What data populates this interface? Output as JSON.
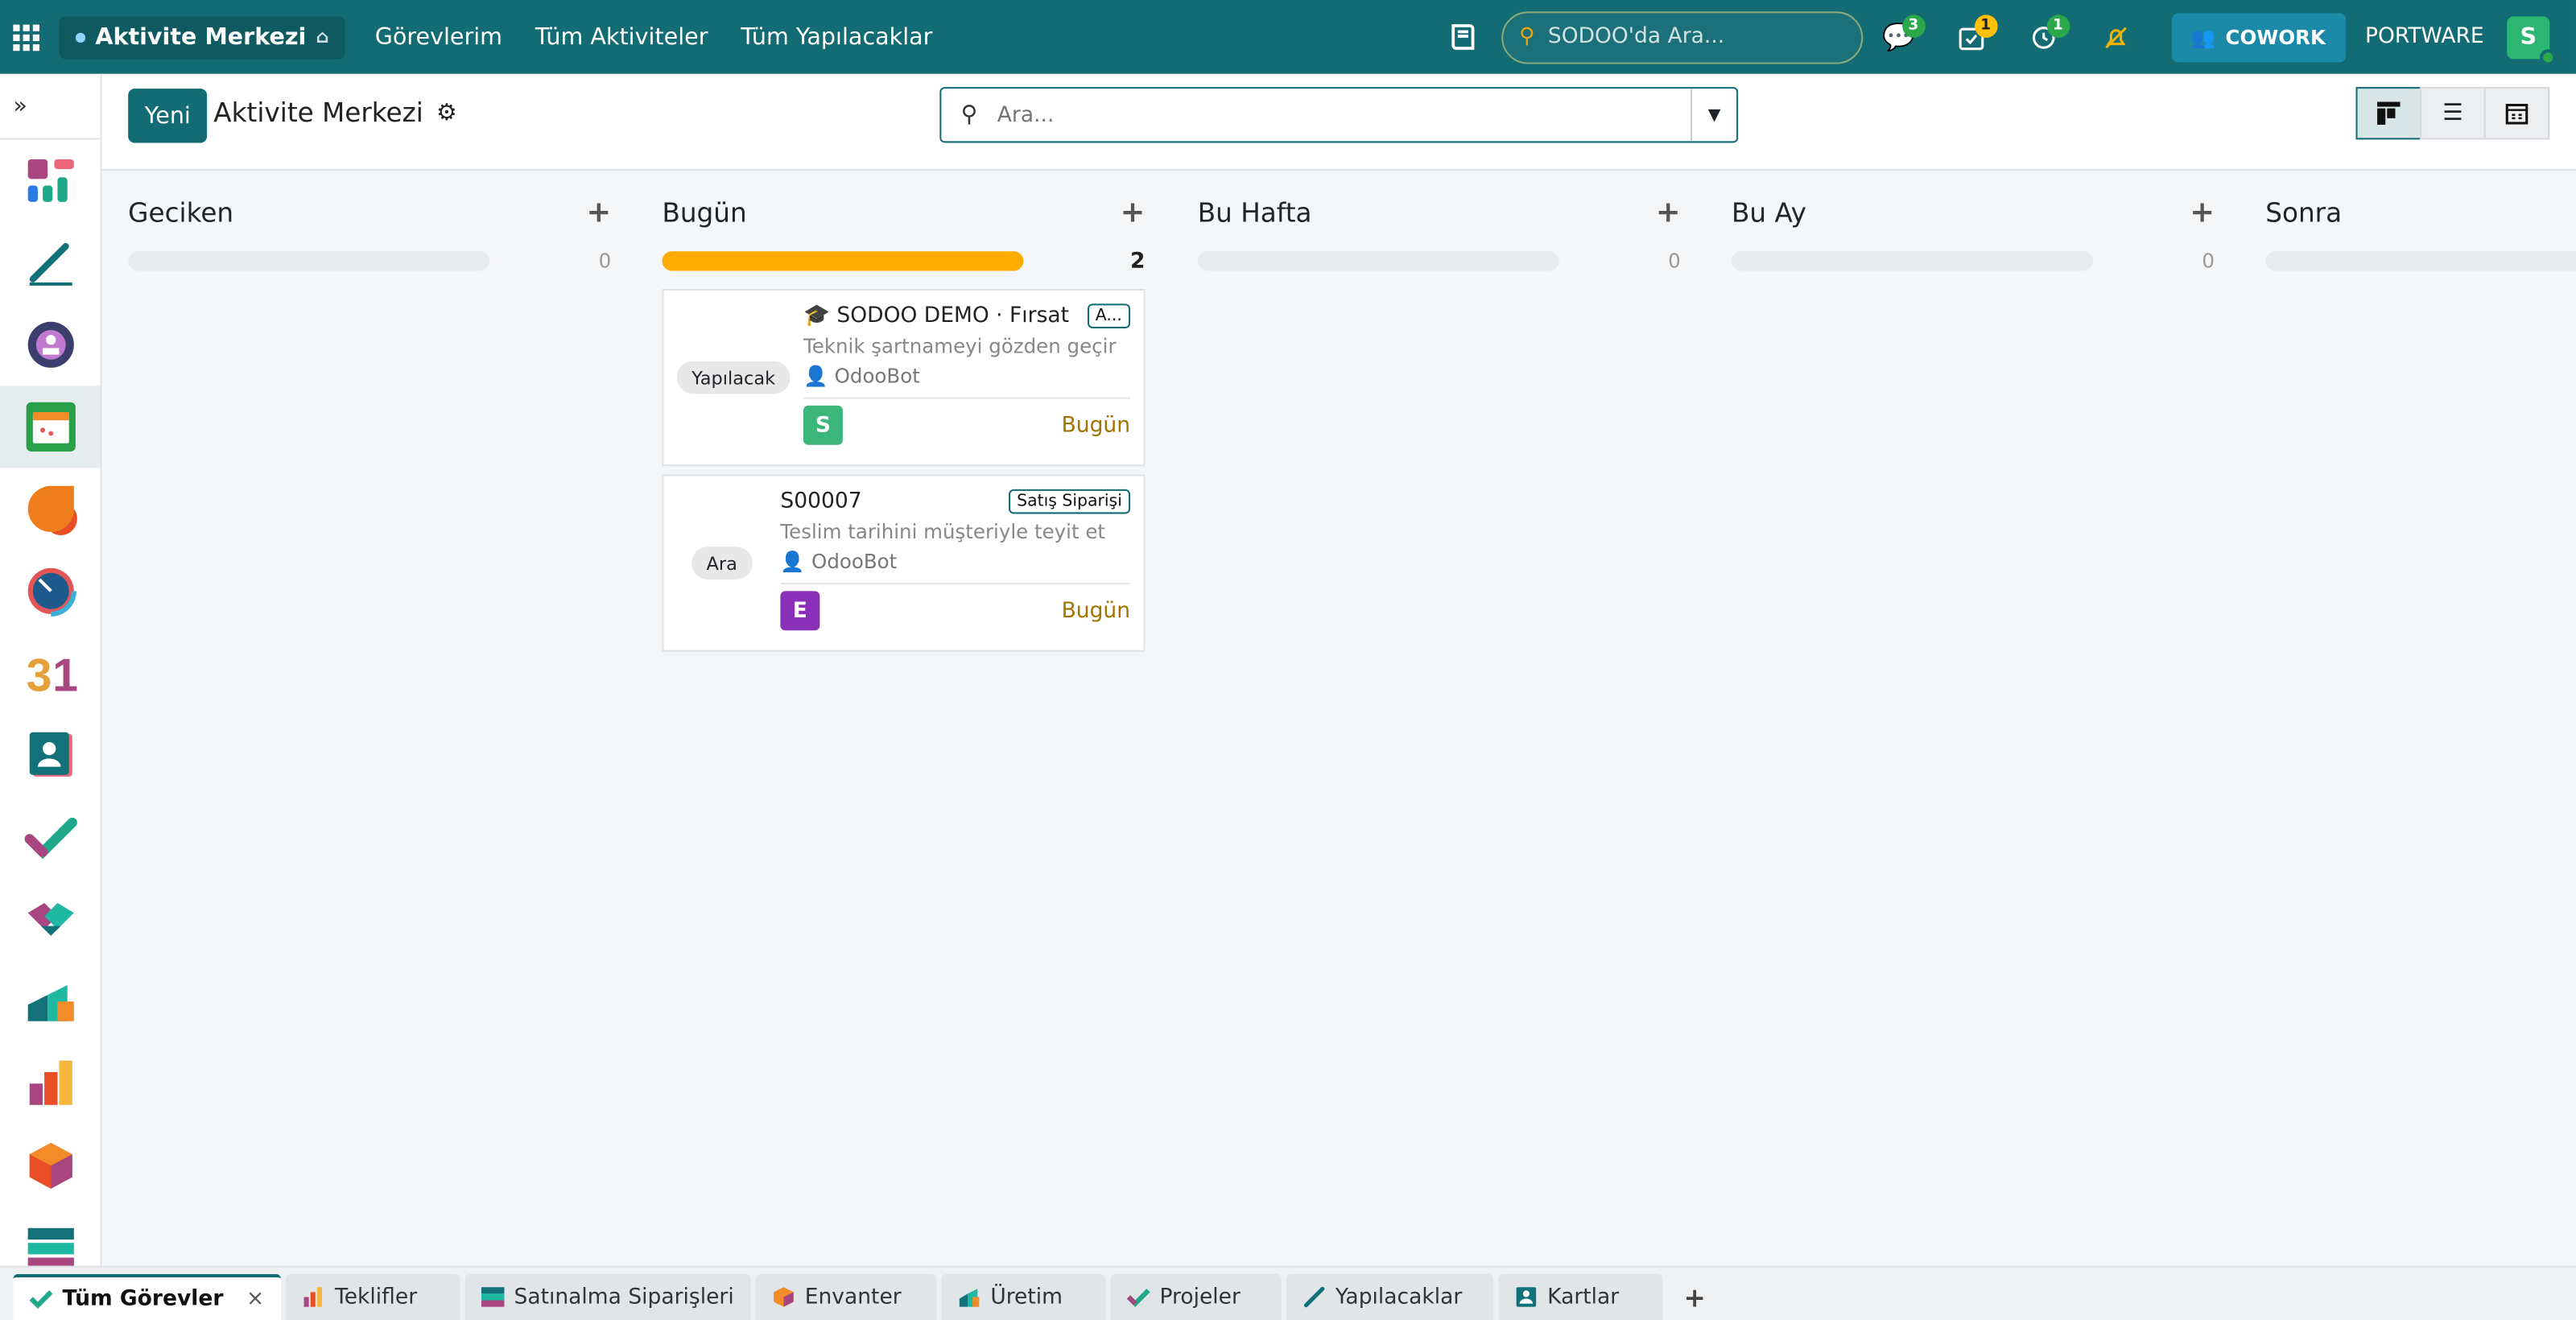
{
  "topbar": {
    "app_name": "Aktivite Merkezi",
    "nav": [
      "Görevlerim",
      "Tüm Aktiviteler",
      "Tüm Yapılacaklar"
    ],
    "search_placeholder": "SODOO'da Ara...",
    "messages_count": "3",
    "activities_count": "1",
    "timer_count": "1",
    "cowork_label": "COWORK",
    "company": "PORTWARE",
    "user_initial": "S",
    "colors": {
      "bar": "#136b73",
      "accent": "#ffc107"
    }
  },
  "sidebar": {
    "toggle": "»",
    "apps": [
      "dashboard-app-icon",
      "documents-app-icon",
      "community-app-icon",
      "activity-center-app-icon",
      "discuss-app-icon",
      "dashboard-gauge-app-icon",
      "calendar-app-icon",
      "contacts-app-icon",
      "todo-app-icon",
      "crm-app-icon",
      "sales-app-icon",
      "reporting-app-icon",
      "inventory-app-icon",
      "purchase-app-icon"
    ]
  },
  "control": {
    "new_button": "Yeni",
    "title": "Aktivite Merkezi",
    "search_placeholder": "Ara..."
  },
  "columns": [
    {
      "title": "Geciken",
      "count": "0",
      "progress": 0
    },
    {
      "title": "Bugün",
      "count": "2",
      "progress": 1
    },
    {
      "title": "Bu Hafta",
      "count": "0",
      "progress": 0
    },
    {
      "title": "Bu Ay",
      "count": "0",
      "progress": 0
    },
    {
      "title": "Sonra",
      "count": "",
      "progress": 0
    }
  ],
  "cards": [
    {
      "type_label": "Yapılacak",
      "title": "🎓 SODOO DEMO · Fırsat",
      "badge": "A...",
      "summary": "Teknik şartnameyi gözden geçir",
      "assignee": "OdooBot",
      "avatar": "S",
      "avatar_color": "#3cb67a",
      "due": "Bugün"
    },
    {
      "type_label": "Ara",
      "title": "S00007",
      "badge": "Satış Siparişi",
      "summary": "Teslim tarihini müşteriyle teyit et",
      "assignee": "OdooBot",
      "avatar": "E",
      "avatar_color": "#8a2fb8",
      "due": "Bugün"
    }
  ],
  "tabs": [
    {
      "label": "Tüm Görevler",
      "active": true,
      "close": "×"
    },
    {
      "label": "Teklifler"
    },
    {
      "label": "Satınalma Siparişleri"
    },
    {
      "label": "Envanter"
    },
    {
      "label": "Üretim"
    },
    {
      "label": "Projeler"
    },
    {
      "label": "Yapılacaklar"
    },
    {
      "label": "Kartlar"
    }
  ],
  "add_tab": "+"
}
